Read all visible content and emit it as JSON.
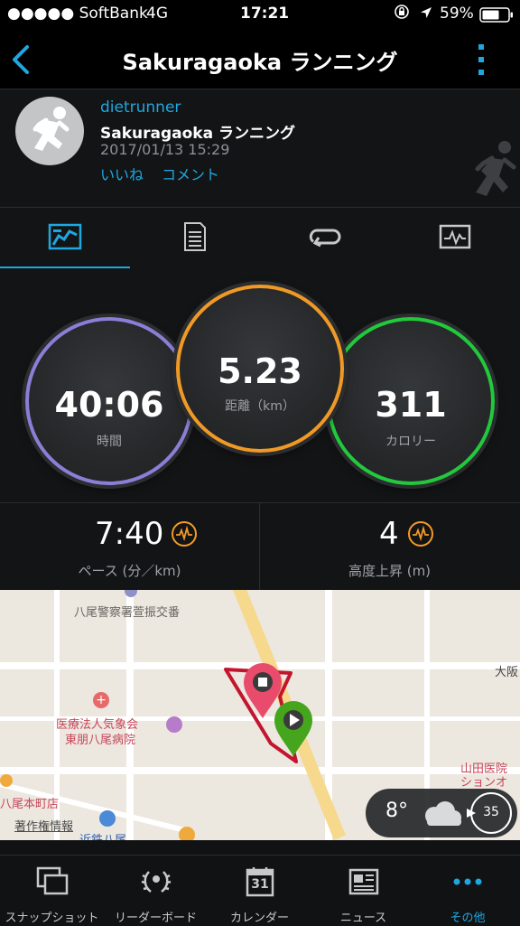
{
  "status_bar": {
    "carrier": "●●●●● SoftBank",
    "network": "4G",
    "time": "17:21",
    "battery": "59%"
  },
  "nav": {
    "title": "Sakuragaoka ランニング"
  },
  "activity": {
    "user": "dietrunner",
    "name": "Sakuragaoka ランニング",
    "datetime": "2017/01/13 15:29",
    "like": "いいね",
    "comment": "コメント"
  },
  "tabs": [
    {
      "icon": "summary-chart-icon",
      "active": true
    },
    {
      "icon": "details-list-icon",
      "active": false
    },
    {
      "icon": "laps-loop-icon",
      "active": false
    },
    {
      "icon": "charts-icon",
      "active": false
    }
  ],
  "stats": {
    "time": {
      "value": "40:06",
      "label": "時間",
      "color": "#8a7fd6"
    },
    "distance": {
      "value": "5.23",
      "label": "距離（km）",
      "color": "#f09a25"
    },
    "calories": {
      "value": "311",
      "label": "カロリー",
      "color": "#22c93c"
    }
  },
  "metrics": {
    "pace": {
      "value": "7:40",
      "label": "ペース (分／km)"
    },
    "elevation": {
      "value": "4",
      "label": "高度上昇 (m)"
    }
  },
  "map": {
    "labels": {
      "police": "八尾警察署萱振交番",
      "hospital1": "医療法人気象会",
      "hospital2": "東朋八尾病院",
      "station_area": "八尾本町店",
      "copyright": "著作権情報",
      "kintetsu": "近鉄八尾",
      "osaka": "大阪",
      "yamada1": "山田医院",
      "yamada2": "ションオ"
    },
    "weather": {
      "temp": "8°",
      "wind": "35"
    }
  },
  "bottom_tabs": [
    {
      "label": "スナップショット",
      "icon": "snapshot-icon"
    },
    {
      "label": "リーダーボード",
      "icon": "leaderboard-laurel-icon"
    },
    {
      "label": "カレンダー",
      "icon": "calendar-icon",
      "day": "31"
    },
    {
      "label": "ニュース",
      "icon": "news-icon"
    },
    {
      "label": "その他",
      "icon": "more-dots-icon",
      "active": true
    }
  ],
  "colors": {
    "accent": "#1fa7e0",
    "background": "#131415",
    "pulse": "#f39a26"
  }
}
